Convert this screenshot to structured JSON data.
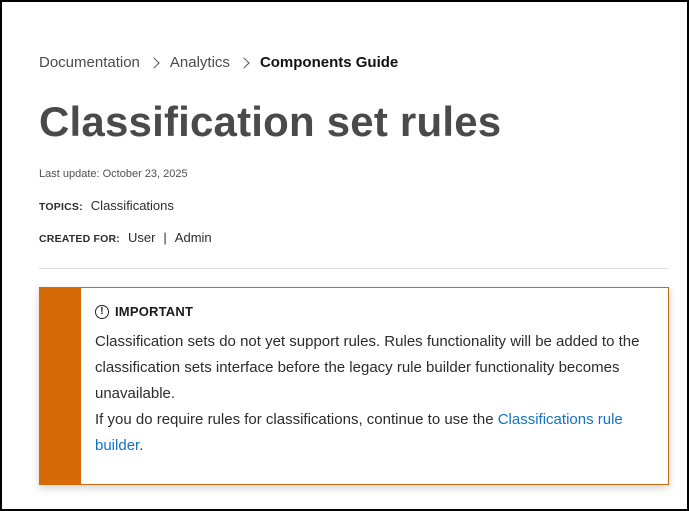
{
  "breadcrumb": {
    "items": [
      "Documentation",
      "Analytics"
    ],
    "current": "Components Guide"
  },
  "page": {
    "title": "Classification set rules",
    "last_update": "Last update: October 23, 2025"
  },
  "meta": {
    "topics_label": "TOPICS:",
    "topics_value": "Classifications",
    "created_for_label": "CREATED FOR:",
    "created_for_values": [
      "User",
      "Admin"
    ]
  },
  "alert": {
    "icon": "info-icon",
    "icon_glyph": "!",
    "heading": "IMPORTANT",
    "paragraph1": "Classification sets do not yet support rules. Rules functionality will be added to the classification sets interface before the legacy rule builder functionality becomes unavailable.",
    "paragraph2_prefix": "If you do require rules for classifications, continue to use the ",
    "link_text": "Classifications rule builder",
    "paragraph2_suffix": ".",
    "stripe_color": "#d66a06",
    "border_color": "#c76c10",
    "link_color": "#1473c6"
  }
}
